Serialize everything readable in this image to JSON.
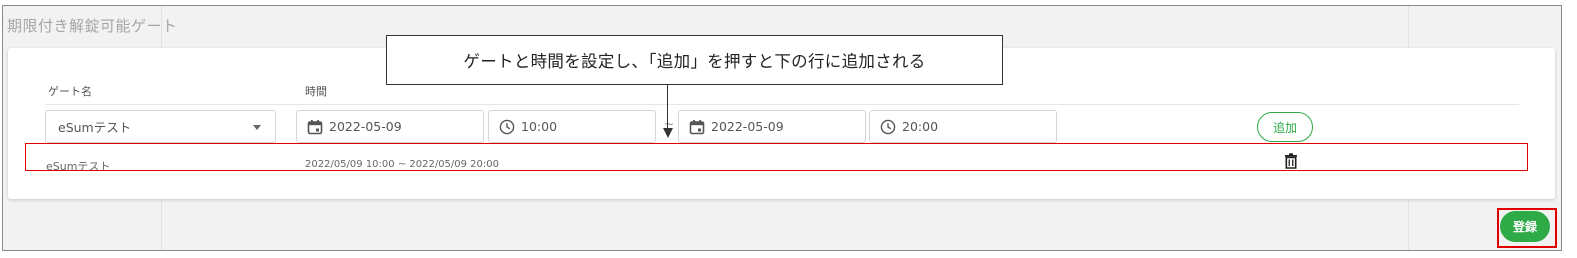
{
  "section": {
    "title": "期限付き解錠可能ゲート"
  },
  "form": {
    "headers": {
      "gate": "ゲート名",
      "time": "時間"
    },
    "gate_select": {
      "value": "eSumテスト"
    },
    "start_date": "2022-05-09",
    "start_time": "10:00",
    "separator": "~",
    "end_date": "2022-05-09",
    "end_time": "20:00",
    "add_label": "追加"
  },
  "rows": [
    {
      "gate": "eSumテスト",
      "period": "2022/05/09 10:00 ~ 2022/05/09 20:00"
    }
  ],
  "annotation": {
    "text": "ゲートと時間を設定し、「追加」を押すと下の行に追加される"
  },
  "footer": {
    "save_label": "登録"
  },
  "colors": {
    "accent": "#2eaa47",
    "highlight": "#e00000"
  },
  "icons": [
    "calendar-icon",
    "clock-icon",
    "chevron-down-icon",
    "trash-icon",
    "arrow-down-icon"
  ]
}
